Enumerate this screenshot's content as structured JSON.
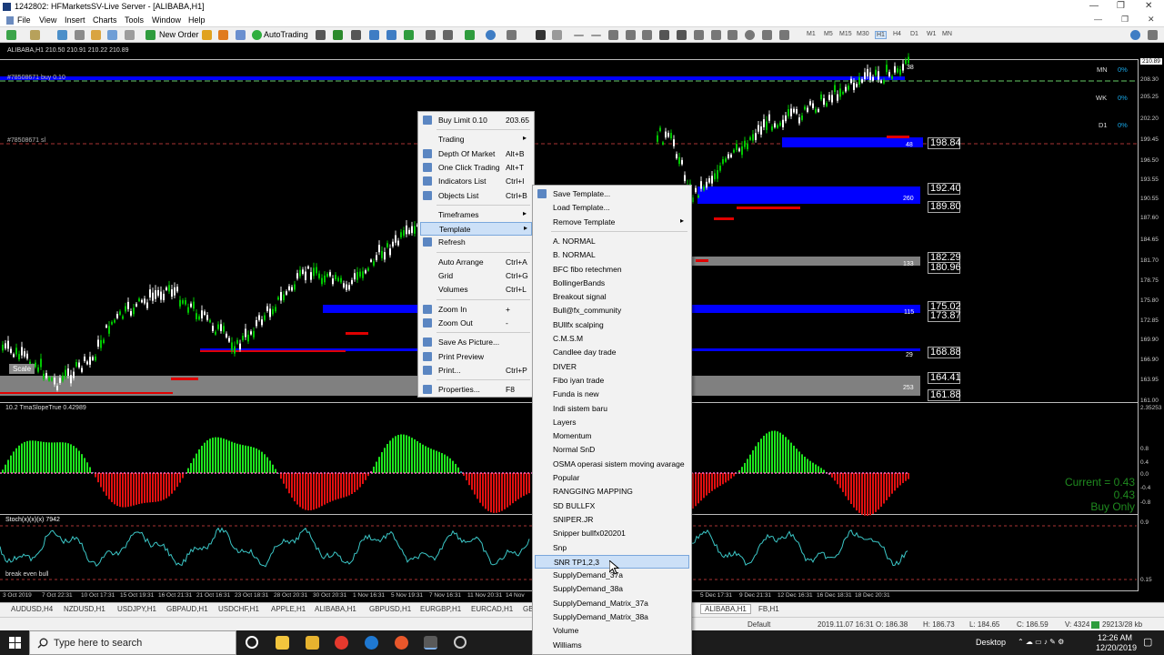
{
  "window": {
    "title": "1242802: HFMarketsSV-Live Server - [ALIBABA,H1]",
    "controls": [
      "—",
      "❐",
      "✕"
    ],
    "mdi_controls": [
      "—",
      "❐",
      "✕"
    ]
  },
  "menubar": [
    "File",
    "View",
    "Insert",
    "Charts",
    "Tools",
    "Window",
    "Help"
  ],
  "toolbar": {
    "new_order": "New Order",
    "autotrading": "AutoTrading",
    "timeframes": [
      "M1",
      "M5",
      "M15",
      "M30",
      "H1",
      "H4",
      "D1",
      "W1",
      "MN"
    ]
  },
  "chart": {
    "symbol_header": "ALIBABA,H1  210.50 210.91 210.22 210.89",
    "order1_label": "#78508671 buy 0.10",
    "order2_label": "#78508671 sl",
    "scale_label": "Scale",
    "indicator1_label": "10.2 TmaSlopeTrue 0.42989",
    "indicator2_label": "break even bull",
    "timeframe_strength": [
      {
        "tf": "MN",
        "value": "0%"
      },
      {
        "tf": "WK",
        "value": "0%"
      },
      {
        "tf": "D1",
        "value": "0%"
      }
    ],
    "levels": [
      "198.84",
      "192.40",
      "189.80",
      "182.29",
      "180.96",
      "175.02",
      "173.87",
      "168.88",
      "164.41",
      "161.88"
    ],
    "level_counts": [
      "48",
      "260",
      "133",
      "115",
      "29",
      "253",
      "38"
    ],
    "current": {
      "line1": "Current = 0.43",
      "line2": "0.43",
      "line3": "Buy Only"
    },
    "price_axis": [
      "210.89",
      "208.30",
      "205.25",
      "202.20",
      "199.45",
      "196.50",
      "193.55",
      "190.55",
      "187.60",
      "184.65",
      "181.70",
      "178.75",
      "175.80",
      "172.85",
      "169.90",
      "166.90",
      "163.95",
      "161.00",
      "2.35253",
      "0.8",
      "0.4",
      "0.0",
      "-0.4",
      "-0.8",
      "0.9",
      "0.15"
    ],
    "time_axis": [
      "3 Oct 2019",
      "7 Oct 22:31",
      "10 Oct 17:31",
      "15 Oct 19:31",
      "16 Oct 21:31",
      "21 Oct 16:31",
      "23 Oct 18:31",
      "28 Oct 20:31",
      "30 Oct 20:31",
      "1 Nov 16:31",
      "5 Nov 19:31",
      "7 Nov 16:31",
      "11 Nov 20:31",
      "14 Nov",
      "5 Dec 17:31",
      "9 Dec 21:31",
      "12 Dec 16:31",
      "16 Dec 18:31",
      "18 Dec 20:31"
    ]
  },
  "context_menu": [
    {
      "label": "Buy Limit 0.10",
      "shortcut": "203.65",
      "icon": "buy-limit-icon"
    },
    {
      "sep": true
    },
    {
      "label": "Trading",
      "submenu": true
    },
    {
      "label": "Depth Of Market",
      "shortcut": "Alt+B",
      "icon": "depth-of-market-icon"
    },
    {
      "label": "One Click Trading",
      "shortcut": "Alt+T",
      "icon": "one-click-trading-icon"
    },
    {
      "label": "Indicators List",
      "shortcut": "Ctrl+I",
      "icon": "indicators-list-icon"
    },
    {
      "label": "Objects List",
      "shortcut": "Ctrl+B",
      "icon": "objects-list-icon"
    },
    {
      "sep": true
    },
    {
      "label": "Timeframes",
      "submenu": true
    },
    {
      "label": "Template",
      "submenu": true,
      "highlight": true
    },
    {
      "label": "Refresh",
      "icon": "refresh-icon"
    },
    {
      "sep": true
    },
    {
      "label": "Auto Arrange",
      "shortcut": "Ctrl+A"
    },
    {
      "label": "Grid",
      "shortcut": "Ctrl+G"
    },
    {
      "label": "Volumes",
      "shortcut": "Ctrl+L"
    },
    {
      "sep": true
    },
    {
      "label": "Zoom In",
      "shortcut": "+",
      "icon": "zoom-in-icon"
    },
    {
      "label": "Zoom Out",
      "shortcut": "-",
      "icon": "zoom-out-icon"
    },
    {
      "sep": true
    },
    {
      "label": "Save As Picture...",
      "icon": "save-picture-icon"
    },
    {
      "label": "Print Preview",
      "icon": "print-preview-icon"
    },
    {
      "label": "Print...",
      "shortcut": "Ctrl+P",
      "icon": "print-icon"
    },
    {
      "sep": true
    },
    {
      "label": "Properties...",
      "shortcut": "F8",
      "icon": "properties-icon"
    }
  ],
  "template_menu": [
    {
      "label": "Save Template...",
      "icon": "save-template-icon"
    },
    {
      "label": "Load Template..."
    },
    {
      "label": "Remove Template",
      "submenu": true
    },
    {
      "sep": true
    },
    {
      "label": "A. NORMAL"
    },
    {
      "label": "B. NORMAL"
    },
    {
      "label": "BFC fibo retechmen"
    },
    {
      "label": "BollingerBands"
    },
    {
      "label": "Breakout signal"
    },
    {
      "label": "Bull@fx_community"
    },
    {
      "label": "BUllfx scalping"
    },
    {
      "label": "C.M.S.M"
    },
    {
      "label": "Candlee day trade"
    },
    {
      "label": "DIVER"
    },
    {
      "label": "Fibo iyan trade"
    },
    {
      "label": "Funda is new"
    },
    {
      "label": "Indi sistem baru"
    },
    {
      "label": "Layers"
    },
    {
      "label": "Momentum"
    },
    {
      "label": "Normal SnD"
    },
    {
      "label": "OSMA operasi sistem moving avarage"
    },
    {
      "label": "Popular"
    },
    {
      "label": "RANGGING MAPPING"
    },
    {
      "label": "SD BULLFX"
    },
    {
      "label": "SNIPER.JR"
    },
    {
      "label": "Snipper bullfx020201"
    },
    {
      "label": "Snp"
    },
    {
      "label": "SNR TP1,2,3",
      "highlight": true
    },
    {
      "label": "SupplyDemand_37a"
    },
    {
      "label": "SupplyDemand_38a"
    },
    {
      "label": "SupplyDemand_Matrix_37a"
    },
    {
      "label": "SupplyDemand_Matrix_38a"
    },
    {
      "label": "Volume"
    },
    {
      "label": "Williams"
    }
  ],
  "symbol_tabs": [
    {
      "label": "AUDUSD,H4"
    },
    {
      "label": "NZDUSD,H1"
    },
    {
      "label": "USDJPY,H1"
    },
    {
      "label": "GBPAUD,H1"
    },
    {
      "label": "USDCHF,H1"
    },
    {
      "label": "APPLE,H1"
    },
    {
      "label": "ALIBABA,H1"
    },
    {
      "label": "GBPUSD,H1"
    },
    {
      "label": "EURGBP,H1"
    },
    {
      "label": "EURCAD,H1"
    },
    {
      "label": "GB"
    },
    {
      "label": "ALIBABA,H1",
      "active": true
    },
    {
      "label": "FB,H1"
    }
  ],
  "statusbar": {
    "profile": "Default",
    "datetime": "2019.11.07 16:31",
    "open": "O: 186.38",
    "high": "H: 186.73",
    "low": "L: 184.65",
    "close": "C: 186.59",
    "volume": "V: 4324",
    "traffic": "29213/28 kb"
  },
  "taskbar": {
    "search_placeholder": "Type here to search",
    "desktop": "Desktop",
    "time": "12:26 AM",
    "date": "12/20/2019"
  },
  "colors": {
    "bull": "#00c800",
    "bear": "#e00000",
    "zone_blue": "#0000ff",
    "zone_gray": "#808080",
    "hist_green": "#1ee61e",
    "hist_red": "#e01010",
    "hist_pink": "#ff6ec7",
    "hist_teal": "#15a0a0"
  }
}
